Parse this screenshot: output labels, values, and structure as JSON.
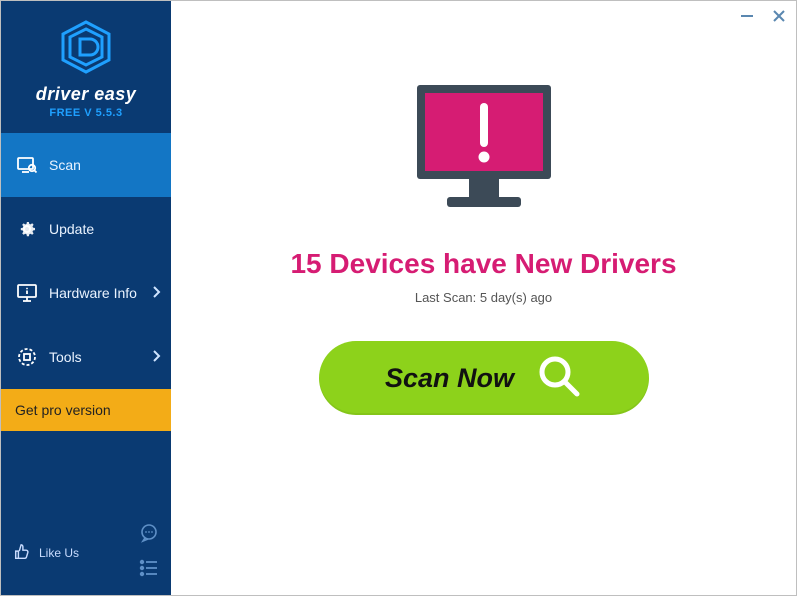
{
  "brand": {
    "name": "driver easy",
    "version": "FREE V 5.5.3"
  },
  "sidebar": {
    "items": [
      {
        "label": "Scan",
        "icon": "scan",
        "active": true,
        "chevron": false
      },
      {
        "label": "Update",
        "icon": "gear",
        "active": false,
        "chevron": false
      },
      {
        "label": "Hardware Info",
        "icon": "monitor-info",
        "active": false,
        "chevron": true
      },
      {
        "label": "Tools",
        "icon": "tools",
        "active": false,
        "chevron": true
      }
    ],
    "get_pro": "Get pro version",
    "like_us": "Like Us"
  },
  "main": {
    "headline": "15 Devices have New Drivers",
    "last_scan": "Last Scan: 5 day(s) ago",
    "scan_button": "Scan Now"
  },
  "colors": {
    "accent_pink": "#d61c73",
    "scan_green": "#8dd21b",
    "sidebar_blue": "#0a3a72",
    "active_blue": "#1376c5",
    "pro_orange": "#f3ac17"
  }
}
